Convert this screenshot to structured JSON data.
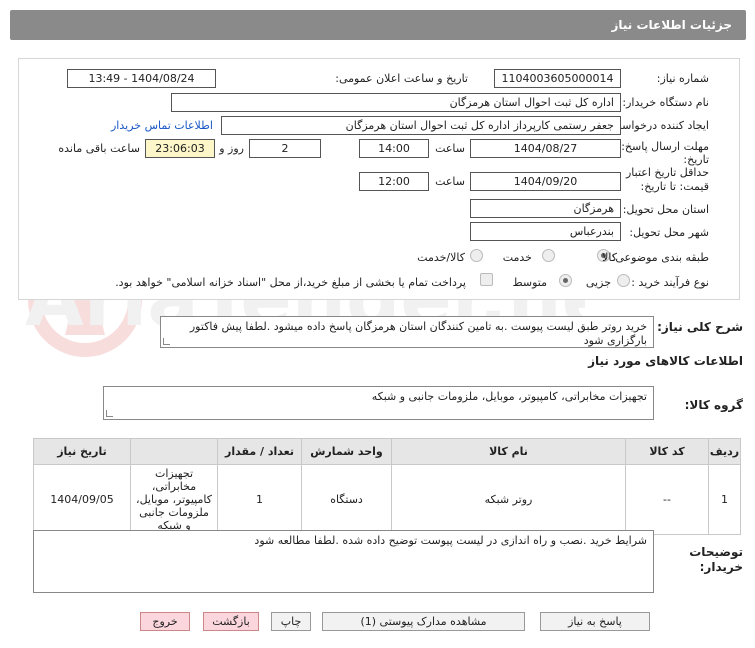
{
  "header": {
    "title": "جزئیات اطلاعات نیاز"
  },
  "form": {
    "need_number_label": "شماره نیاز:",
    "need_number": "1104003605000014",
    "announce_label": "تاریخ و ساعت اعلان عمومی:",
    "announce_value": "1404/08/24 - 13:49",
    "buyer_label": "نام دستگاه خریدار:",
    "buyer_value": "اداره کل ثبت احوال استان هرمزگان",
    "creator_label": "ایجاد کننده درخواست:",
    "creator_value": "جعفر رستمی کارپرداز اداره کل ثبت احوال استان هرمزگان",
    "contact_link": "اطلاعات تماس خریدار",
    "deadline_label_1": "مهلت ارسال پاسخ: تا",
    "deadline_label_2": "تاریخ:",
    "deadline_date": "1404/08/27",
    "time_label": "ساعت",
    "deadline_time": "14:00",
    "days_value": "2",
    "days_label": "روز و",
    "remaining_value": "23:06:03",
    "remaining_label": "ساعت باقی مانده",
    "validity_label_1": "حداقل تاریخ اعتبار",
    "validity_label_2": "قیمت: تا تاریخ:",
    "validity_date": "1404/09/20",
    "validity_time": "12:00",
    "province_label": "استان محل تحویل:",
    "province_value": "هرمزگان",
    "city_label": "شهر محل تحویل:",
    "city_value": "بندرعباس",
    "category_label": "طبقه بندی موضوعی:",
    "category_options": [
      "کالا",
      "خدمت",
      "کالا/خدمت"
    ],
    "process_label": "نوع فرآیند خرید :",
    "process_options": [
      "جزیی",
      "متوسط"
    ],
    "treasury_note": "پرداخت تمام یا بخشی از مبلغ خرید،از محل \"اسناد خزانه اسلامی\" خواهد بود."
  },
  "summary": {
    "label": "شرح کلی نیاز:",
    "text": "خرید روتر طبق لیست پیوست .به تامین کنندگان استان هرمزگان پاسخ داده میشود .لطفا پیش فاکتور بارگزاری شود"
  },
  "goods": {
    "section_title": "اطلاعات کالاهای مورد نیاز",
    "group_label": "گروه کالا:",
    "group_value": "تجهیزات مخابراتی، کامپیوتر، موبایل، ملزومات جانبی و شبکه"
  },
  "table": {
    "headers": [
      "ردیف",
      "کد کالا",
      "نام کالا",
      "واحد شمارش",
      "تعداد / مقدار",
      "تاریخ نیاز"
    ],
    "rows": [
      [
        "1",
        "--",
        "روتر شبکه",
        "دستگاه",
        "1",
        "1404/09/05"
      ]
    ],
    "row_category": "تجهیزات مخابراتی، کامپیوتر، موبایل، ملزومات جانبی و شبکه"
  },
  "buyer_notes": {
    "label_1": "توضیحات",
    "label_2": "خریدار:",
    "text": "شرایط خرید .نصب و راه اندازی در لیست پیوست توضیح داده شده .لطفا مطالعه شود"
  },
  "buttons": {
    "reply": "پاسخ به نیاز",
    "view_docs": "مشاهده مدارک پیوستی (1)",
    "print": "چاپ",
    "back": "بازگشت",
    "exit": "خروج"
  },
  "watermark_text": "AriaTender.neT"
}
